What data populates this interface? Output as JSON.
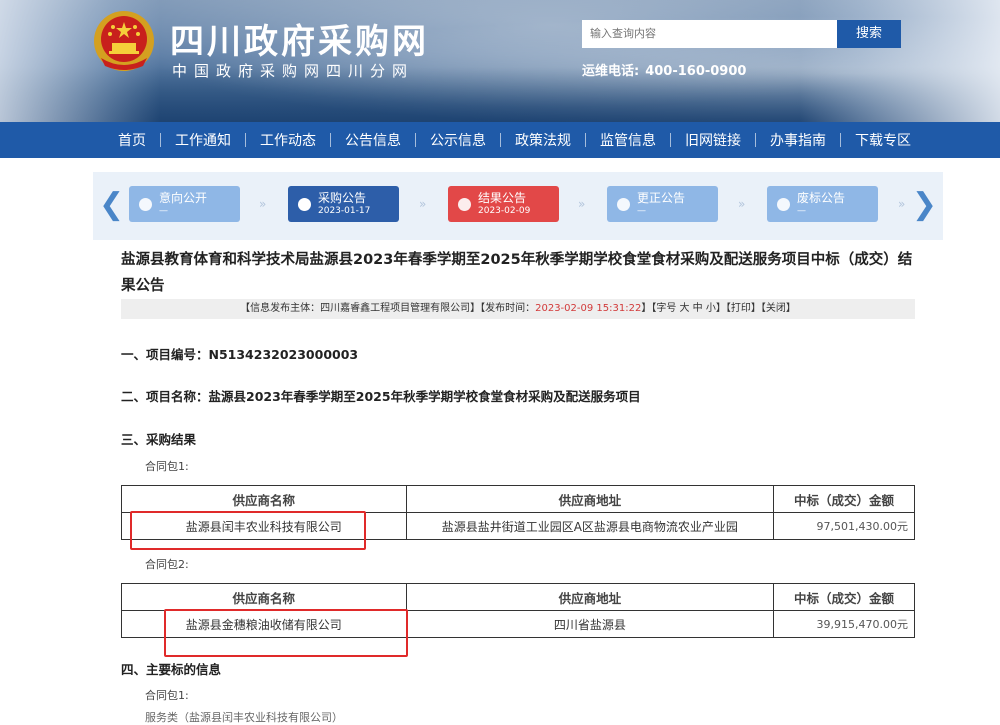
{
  "header": {
    "site_title": "四川政府采购网",
    "site_subtitle": "中国政府采购网四川分网",
    "search_placeholder": "输入查询内容",
    "search_button": "搜索",
    "hotline_label": "运维电话:",
    "hotline_number": "400-160-0900"
  },
  "nav": {
    "items": [
      "首页",
      "工作通知",
      "工作动态",
      "公告信息",
      "公示信息",
      "政策法规",
      "监管信息",
      "旧网链接",
      "办事指南",
      "下载专区"
    ]
  },
  "process": {
    "steps": [
      {
        "label": "意向公开",
        "date": "—",
        "state": "light"
      },
      {
        "label": "采购公告",
        "date": "2023-01-17",
        "state": "active"
      },
      {
        "label": "结果公告",
        "date": "2023-02-09",
        "state": "red"
      },
      {
        "label": "更正公告",
        "date": "—",
        "state": "light"
      },
      {
        "label": "废标公告",
        "date": "—",
        "state": "light"
      }
    ]
  },
  "article": {
    "title": "盐源县教育体育和科学技术局盐源县2023年春季学期至2025年秋季学期学校食堂食材采购及配送服务项目中标（成交）结果公告",
    "info_publisher": "【信息发布主体：四川嘉睿鑫工程项目管理有限公司】【发布时间：",
    "info_time": "2023-02-09 15:31:22",
    "info_tail": "】【字号 大 中 小】【打印】【关闭】",
    "section1": "一、项目编号：N5134232023000003",
    "section2": "二、项目名称：盐源县2023年春季学期至2025年秋季学期学校食堂食材采购及配送服务项目",
    "section3": "三、采购结果",
    "package1_label": "合同包1:",
    "package2_label": "合同包2:",
    "table_headers": [
      "供应商名称",
      "供应商地址",
      "中标（成交）金额"
    ],
    "package1_rows": [
      {
        "name": "盐源县闰丰农业科技有限公司",
        "address": "盐源县盐井街道工业园区A区盐源县电商物流农业产业园",
        "amount": "97,501,430.00元"
      }
    ],
    "package2_rows": [
      {
        "name": "盐源县金穗粮油收储有限公司",
        "address": "四川省盐源县",
        "amount": "39,915,470.00元"
      }
    ],
    "section4": "四、主要标的信息",
    "package_info_label": "合同包1:",
    "faded_line": "服务类（盐源县闰丰农业科技有限公司）"
  },
  "colors": {
    "nav_bg": "#1f5aa8",
    "step_active": "#2d5ea9",
    "step_light": "#8fb7e6",
    "step_red": "#e24848",
    "highlight": "#e02a2a"
  }
}
